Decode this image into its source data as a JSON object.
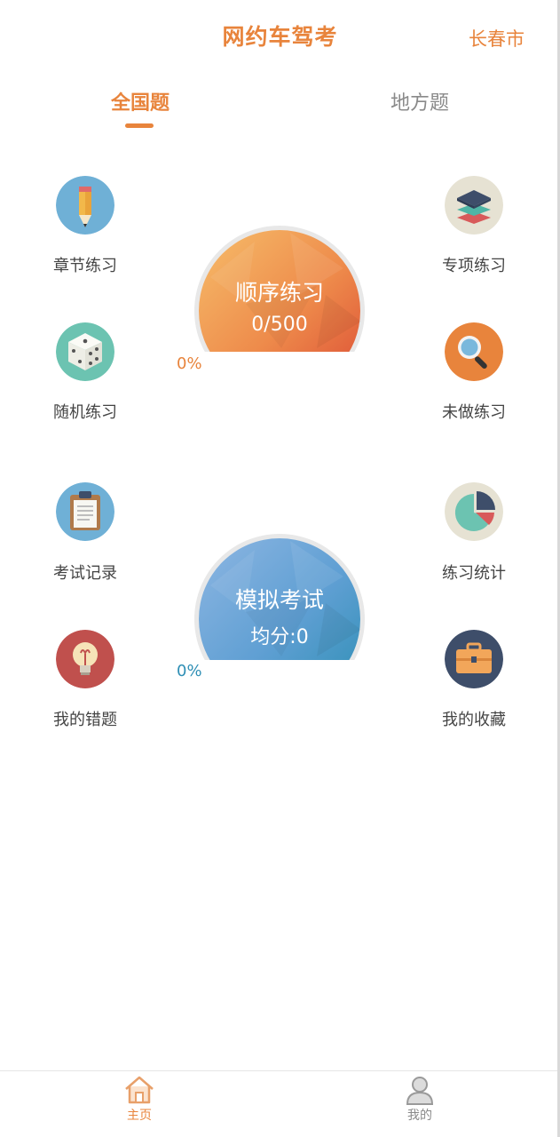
{
  "header": {
    "title": "网约车驾考",
    "city": "长春市"
  },
  "tabs": [
    {
      "label": "全国题",
      "active": true
    },
    {
      "label": "地方题",
      "active": false
    }
  ],
  "colors": {
    "accent": "#e8843c",
    "inactive": "#8a8a8a",
    "blue": "#2f8fb5"
  },
  "practice": {
    "left": [
      {
        "label": "章节练习",
        "icon": "pencil-icon"
      },
      {
        "label": "随机练习",
        "icon": "dice-icon"
      }
    ],
    "right": [
      {
        "label": "专项练习",
        "icon": "layers-icon"
      },
      {
        "label": "未做练习",
        "icon": "magnifier-icon"
      }
    ],
    "gauge": {
      "title": "顺序练习",
      "progress": "0/500",
      "percent": "0%"
    }
  },
  "exam": {
    "left": [
      {
        "label": "考试记录",
        "icon": "clipboard-icon"
      },
      {
        "label": "我的错题",
        "icon": "lightbulb-icon"
      }
    ],
    "right": [
      {
        "label": "练习统计",
        "icon": "pie-chart-icon"
      },
      {
        "label": "我的收藏",
        "icon": "briefcase-icon"
      }
    ],
    "gauge": {
      "title": "模拟考试",
      "average": "均分:0",
      "percent": "0%"
    }
  },
  "bottom_nav": [
    {
      "label": "主页",
      "icon": "home-icon",
      "active": true
    },
    {
      "label": "我的",
      "icon": "user-icon",
      "active": false
    }
  ]
}
